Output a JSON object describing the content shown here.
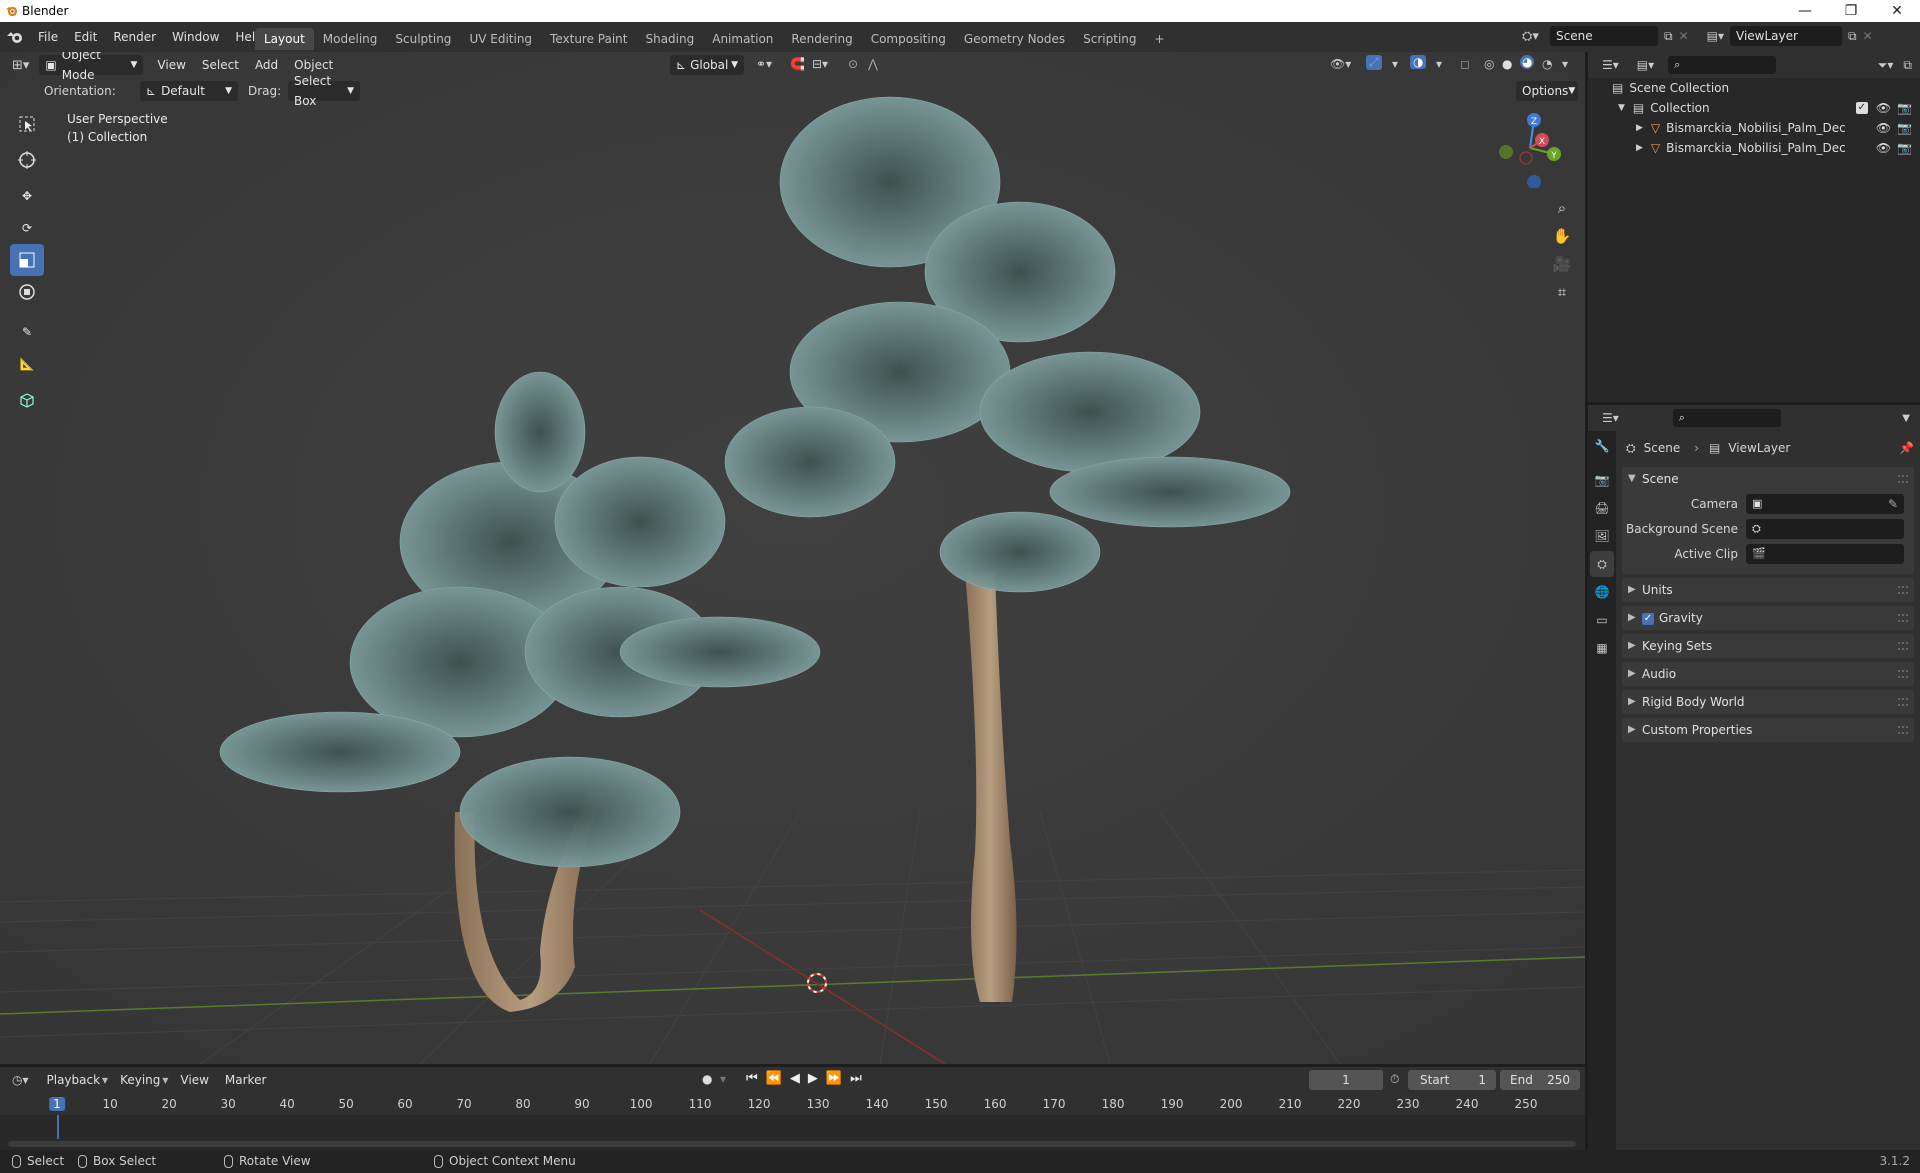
{
  "window": {
    "title": "Blender",
    "controls": [
      "minimize",
      "restore",
      "close"
    ]
  },
  "menubar": {
    "menus": [
      "File",
      "Edit",
      "Render",
      "Window",
      "Help"
    ],
    "workspaces": [
      "Layout",
      "Modeling",
      "Sculpting",
      "UV Editing",
      "Texture Paint",
      "Shading",
      "Animation",
      "Rendering",
      "Compositing",
      "Geometry Nodes",
      "Scripting"
    ],
    "active_workspace": "Layout",
    "add_tab": "+",
    "scene_name": "Scene",
    "view_layer": "ViewLayer"
  },
  "viewport": {
    "mode": "Object Mode",
    "menus": [
      "View",
      "Select",
      "Add",
      "Object"
    ],
    "transform_orientation": "Global",
    "orientation_label": "Orientation:",
    "orientation_value": "Default",
    "drag_label": "Drag:",
    "drag_value": "Select Box",
    "options_label": "Options",
    "overlay_text": [
      "User Perspective",
      "(1) Collection"
    ],
    "gizmo_axes": [
      "Z",
      "X",
      "Y"
    ],
    "tools": [
      "select-box",
      "cursor",
      "move",
      "rotate",
      "scale",
      "transform",
      "annotate",
      "measure",
      "add-cube"
    ],
    "active_tool": "scale"
  },
  "outliner": {
    "items": [
      {
        "label": "Scene Collection",
        "level": 0
      },
      {
        "label": "Collection",
        "level": 1
      },
      {
        "label": "Bismarckia_Nobilisi_Palm_Decorativ",
        "level": 2
      },
      {
        "label": "Bismarckia_Nobilisi_Palm_Decorativ",
        "level": 2
      }
    ]
  },
  "properties": {
    "breadcrumb": [
      "Scene",
      "ViewLayer"
    ],
    "scene_panel": {
      "title": "Scene",
      "fields": [
        {
          "label": "Camera",
          "value": ""
        },
        {
          "label": "Background Scene",
          "value": ""
        },
        {
          "label": "Active Clip",
          "value": ""
        }
      ]
    },
    "collapsed_panels": [
      "Units",
      "Gravity",
      "Keying Sets",
      "Audio",
      "Rigid Body World",
      "Custom Properties"
    ],
    "gravity_checked": true
  },
  "timeline": {
    "menus": [
      "Playback",
      "Keying",
      "View",
      "Marker"
    ],
    "current_frame": "1",
    "start_label": "Start",
    "start_value": "1",
    "end_label": "End",
    "end_value": "250",
    "ruler_ticks": [
      "1",
      "10",
      "20",
      "30",
      "40",
      "50",
      "60",
      "70",
      "80",
      "90",
      "100",
      "110",
      "120",
      "130",
      "140",
      "150",
      "160",
      "170",
      "180",
      "190",
      "200",
      "210",
      "220",
      "230",
      "240",
      "250"
    ]
  },
  "statusbar": {
    "hints": [
      "Select",
      "Box Select",
      "Rotate View",
      "Object Context Menu"
    ],
    "version": "3.1.2"
  }
}
